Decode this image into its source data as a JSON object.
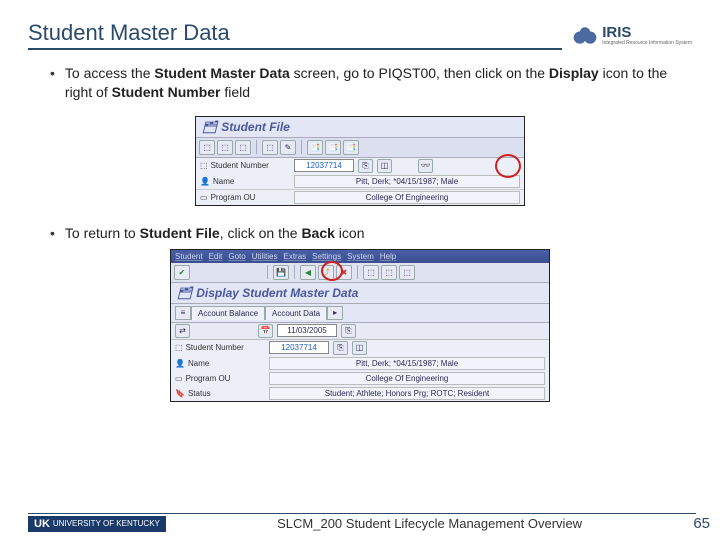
{
  "title": "Student Master Data",
  "logo": {
    "text": "IRIS",
    "subtext": "Integrated Resource Information System"
  },
  "bullet1": {
    "pre": "To access the ",
    "b1": "Student Master Data",
    "mid1": " screen, go to PIQST00, then click on the ",
    "b2": "Display",
    "mid2": " icon to the right of ",
    "b3": "Student Number",
    "post": " field"
  },
  "bullet2": {
    "pre": "To return to ",
    "b1": "Student File",
    "mid": ", click on the ",
    "b2": "Back",
    "post": " icon"
  },
  "sap1": {
    "header": "Student File",
    "labels": {
      "stnum": "Student Number",
      "name": "Name",
      "pou": "Program OU"
    },
    "values": {
      "stnum": "12037714",
      "name": "Pitt, Derk; *04/15/1987; Male",
      "pou": "College Of Engineering"
    }
  },
  "sap2": {
    "menu": [
      "Student",
      "Edit",
      "Goto",
      "Utilities",
      "Extras",
      "Settings",
      "System",
      "Help"
    ],
    "header": "Display Student Master Data",
    "tabs": [
      "Account Balance",
      "Account Data"
    ],
    "date": "11/03/2005",
    "labels": {
      "stnum": "Student Number",
      "name": "Name",
      "pou": "Program OU",
      "status": "Status"
    },
    "values": {
      "stnum": "12037714",
      "name": "Pitt, Derk; *04/15/1987; Male",
      "pou": "College Of Engineering",
      "status": "Student; Athlete; Honors Prg; ROTC; Resident"
    }
  },
  "footer": {
    "uk": "UNIVERSITY OF KENTUCKY",
    "text": "SLCM_200 Student Lifecycle Management Overview",
    "page": "65"
  }
}
